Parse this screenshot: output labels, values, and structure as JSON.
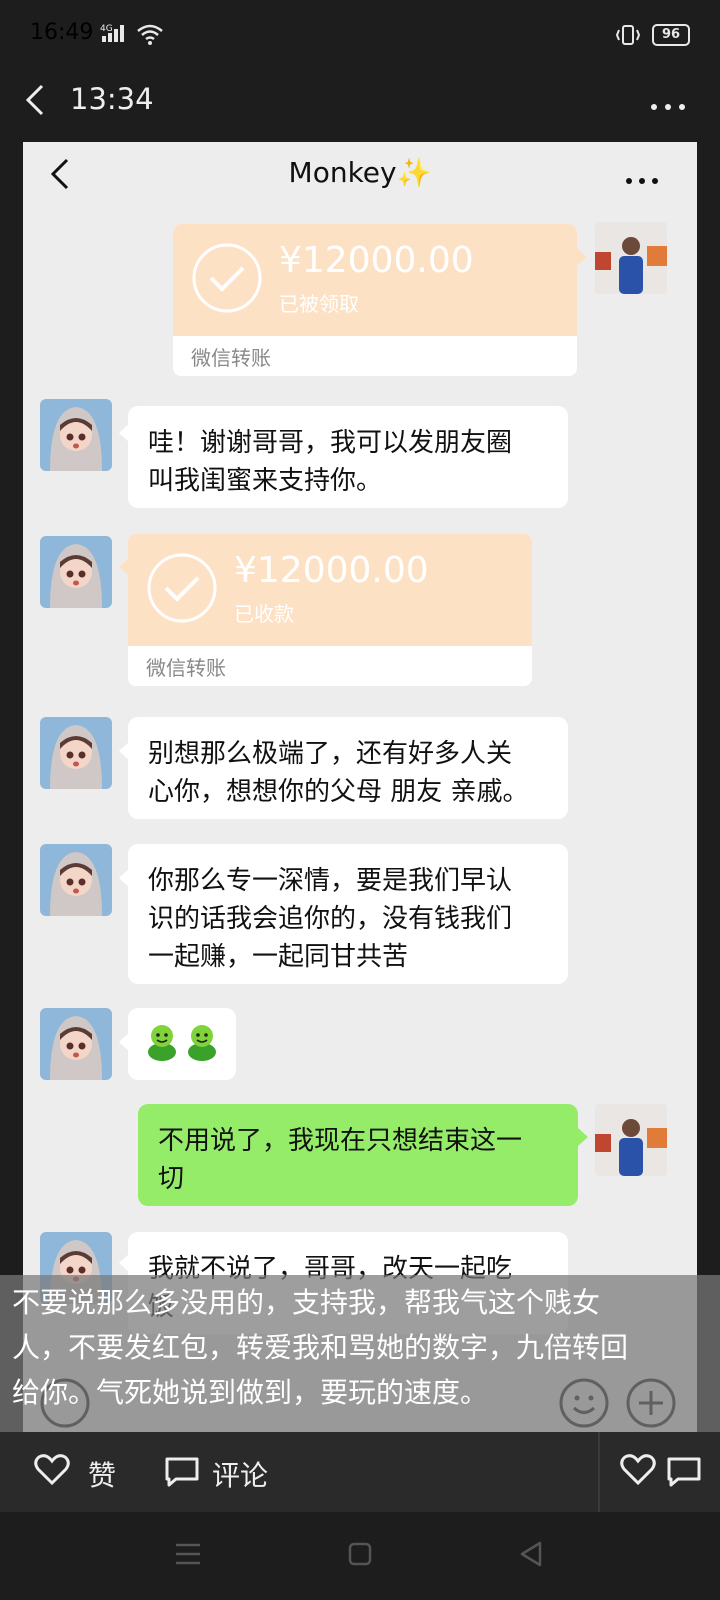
{
  "status_bar": {
    "time": "16:49",
    "network": "4G",
    "battery": "96"
  },
  "app_bar": {
    "title": "13:34",
    "back_icon": "back-arrow-icon",
    "more_icon": "more-icon"
  },
  "chat": {
    "title": "Monkey✨",
    "transfer_1": {
      "amount": "¥12000.00",
      "status": "已被领取",
      "footer": "微信转账"
    },
    "msg_1": {
      "line1": "哇！谢谢哥哥，我可以发朋友圈",
      "line2": "叫我闺蜜来支持你。"
    },
    "transfer_2": {
      "amount": "¥12000.00",
      "status": "已收款",
      "footer": "微信转账"
    },
    "msg_2": {
      "line1": "别想那么极端了，还有好多人关",
      "line2": "心你，想想你的父母 朋友 亲戚。"
    },
    "msg_3": {
      "line1": "你那么专一深情，要是我们早认",
      "line2": "识的话我会追你的，没有钱我们",
      "line3": "一起赚，一起同甘共苦"
    },
    "msg_5": {
      "line1": "不用说了，我现在只想结束这一",
      "line2": "切"
    },
    "msg_6": {
      "line1": "我就不说了，哥哥，改天一起吃",
      "line2": "饭"
    }
  },
  "overlay": {
    "line1": "不要说那么多没用的，支持我，帮我气这个贱女",
    "line2": "人，不要发红包，转爱我和骂她的数字，九倍转回",
    "line3": "给你。气死她说到做到，要玩的速度。"
  },
  "actions": {
    "like_label": "赞",
    "comment_label": "评论"
  },
  "colors": {
    "wechat_green": "#95ec69",
    "transfer_peach": "#fde1c5",
    "chat_bg": "#ededed"
  }
}
